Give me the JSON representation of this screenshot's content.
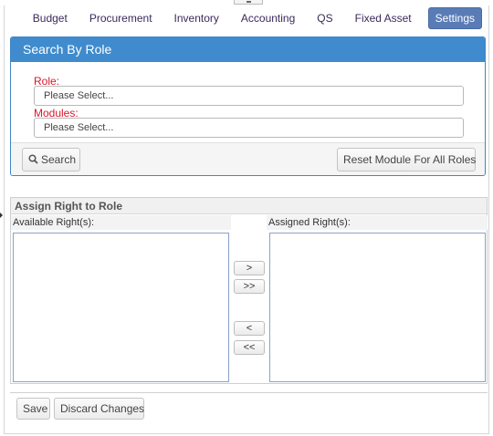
{
  "nav": {
    "items": [
      {
        "label": "Budget"
      },
      {
        "label": "Procurement"
      },
      {
        "label": "Inventory"
      },
      {
        "label": "Accounting"
      },
      {
        "label": "QS"
      },
      {
        "label": "Fixed Asset"
      },
      {
        "label": "Settings",
        "active": true
      }
    ]
  },
  "search_panel": {
    "title": "Search By Role",
    "role_label": "Role:",
    "role_value": "Please Select...",
    "modules_label": "Modules:",
    "modules_value": "Please Select...",
    "search_button": "Search",
    "reset_button": "Reset Module For All Roles"
  },
  "assign_panel": {
    "title": "Assign Right to Role",
    "available_label": "Available Right(s):",
    "assigned_label": "Assigned Right(s):",
    "move_right": ">",
    "move_all_right": ">>",
    "move_left": "<",
    "move_all_left": "<<"
  },
  "footer": {
    "save_button": "Save",
    "discard_button": "Discard Changes"
  },
  "colors": {
    "panel_header": "#3f8bcd",
    "required_label": "#d9182c",
    "active_nav": "#5a7cb6"
  }
}
